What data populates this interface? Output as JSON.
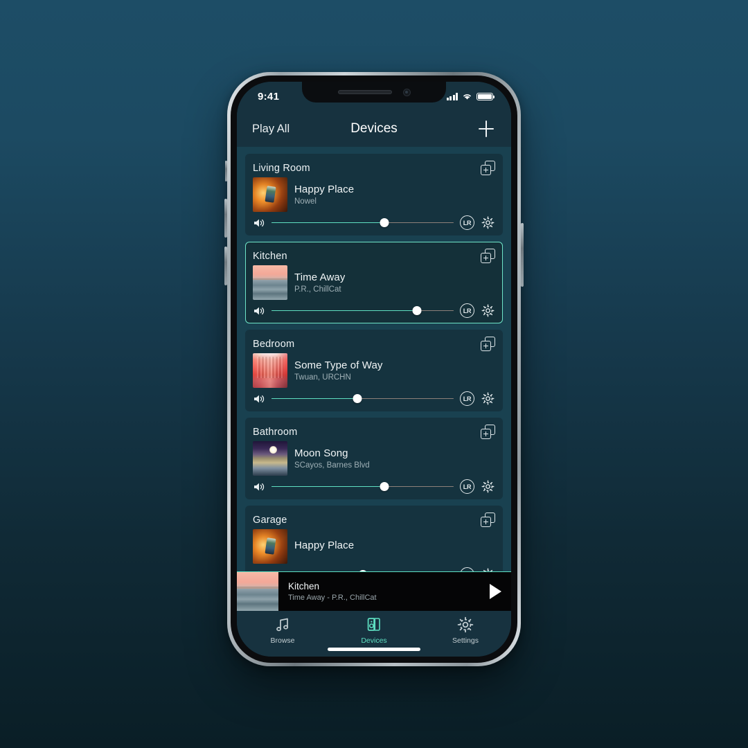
{
  "statusbar": {
    "time": "9:41",
    "signal_icon": "cellular-signal-icon",
    "wifi_icon": "wifi-icon",
    "battery_icon": "battery-full-icon"
  },
  "navbar": {
    "left_action": "Play All",
    "title": "Devices",
    "right_action_icon": "plus-icon"
  },
  "devices": [
    {
      "room": "Living Room",
      "track": "Happy Place",
      "artist": "Nowel",
      "volume": 62,
      "selected": false,
      "art": "art-happy",
      "group_icon": "add-to-group-icon",
      "channel_badge": "LR",
      "settings_icon": "gear-icon",
      "speaker_icon": "speaker-volume-icon"
    },
    {
      "room": "Kitchen",
      "track": "Time Away",
      "artist": "P.R., ChillCat",
      "volume": 80,
      "selected": true,
      "art": "art-time",
      "group_icon": "add-to-group-icon",
      "channel_badge": "LR",
      "settings_icon": "gear-icon",
      "speaker_icon": "speaker-volume-icon"
    },
    {
      "room": "Bedroom",
      "track": "Some Type of Way",
      "artist": "Twuan, URCHN",
      "volume": 47,
      "selected": false,
      "art": "art-some",
      "group_icon": "add-to-group-icon",
      "channel_badge": "LR",
      "settings_icon": "gear-icon",
      "speaker_icon": "speaker-volume-icon"
    },
    {
      "room": "Bathroom",
      "track": "Moon Song",
      "artist": "SCayos, Barnes Blvd",
      "volume": 62,
      "selected": false,
      "art": "art-moon",
      "group_icon": "add-to-group-icon",
      "channel_badge": "LR",
      "settings_icon": "gear-icon",
      "speaker_icon": "speaker-volume-icon"
    },
    {
      "room": "Garage",
      "track": "Happy Place",
      "artist": "",
      "volume": 50,
      "selected": false,
      "art": "art-happy",
      "group_icon": "add-to-group-icon",
      "channel_badge": "LR",
      "settings_icon": "gear-icon",
      "speaker_icon": "speaker-volume-icon"
    }
  ],
  "now_playing": {
    "room": "Kitchen",
    "track_line": "Time Away - P.R., ChillCat",
    "play_icon": "play-icon",
    "art": "art-time"
  },
  "tabs": [
    {
      "label": "Browse",
      "icon": "music-note-icon",
      "active": false
    },
    {
      "label": "Devices",
      "icon": "speakers-icon",
      "active": true
    },
    {
      "label": "Settings",
      "icon": "gear-icon",
      "active": false
    }
  ],
  "colors": {
    "accent": "#5fe0c2",
    "screen_bg": "#17323f",
    "list_bg": "#194150",
    "card_bg": "#15333f",
    "now_playing_bg": "#050506",
    "backdrop_top": "#1d4d66",
    "backdrop_bottom": "#0a1e26"
  }
}
